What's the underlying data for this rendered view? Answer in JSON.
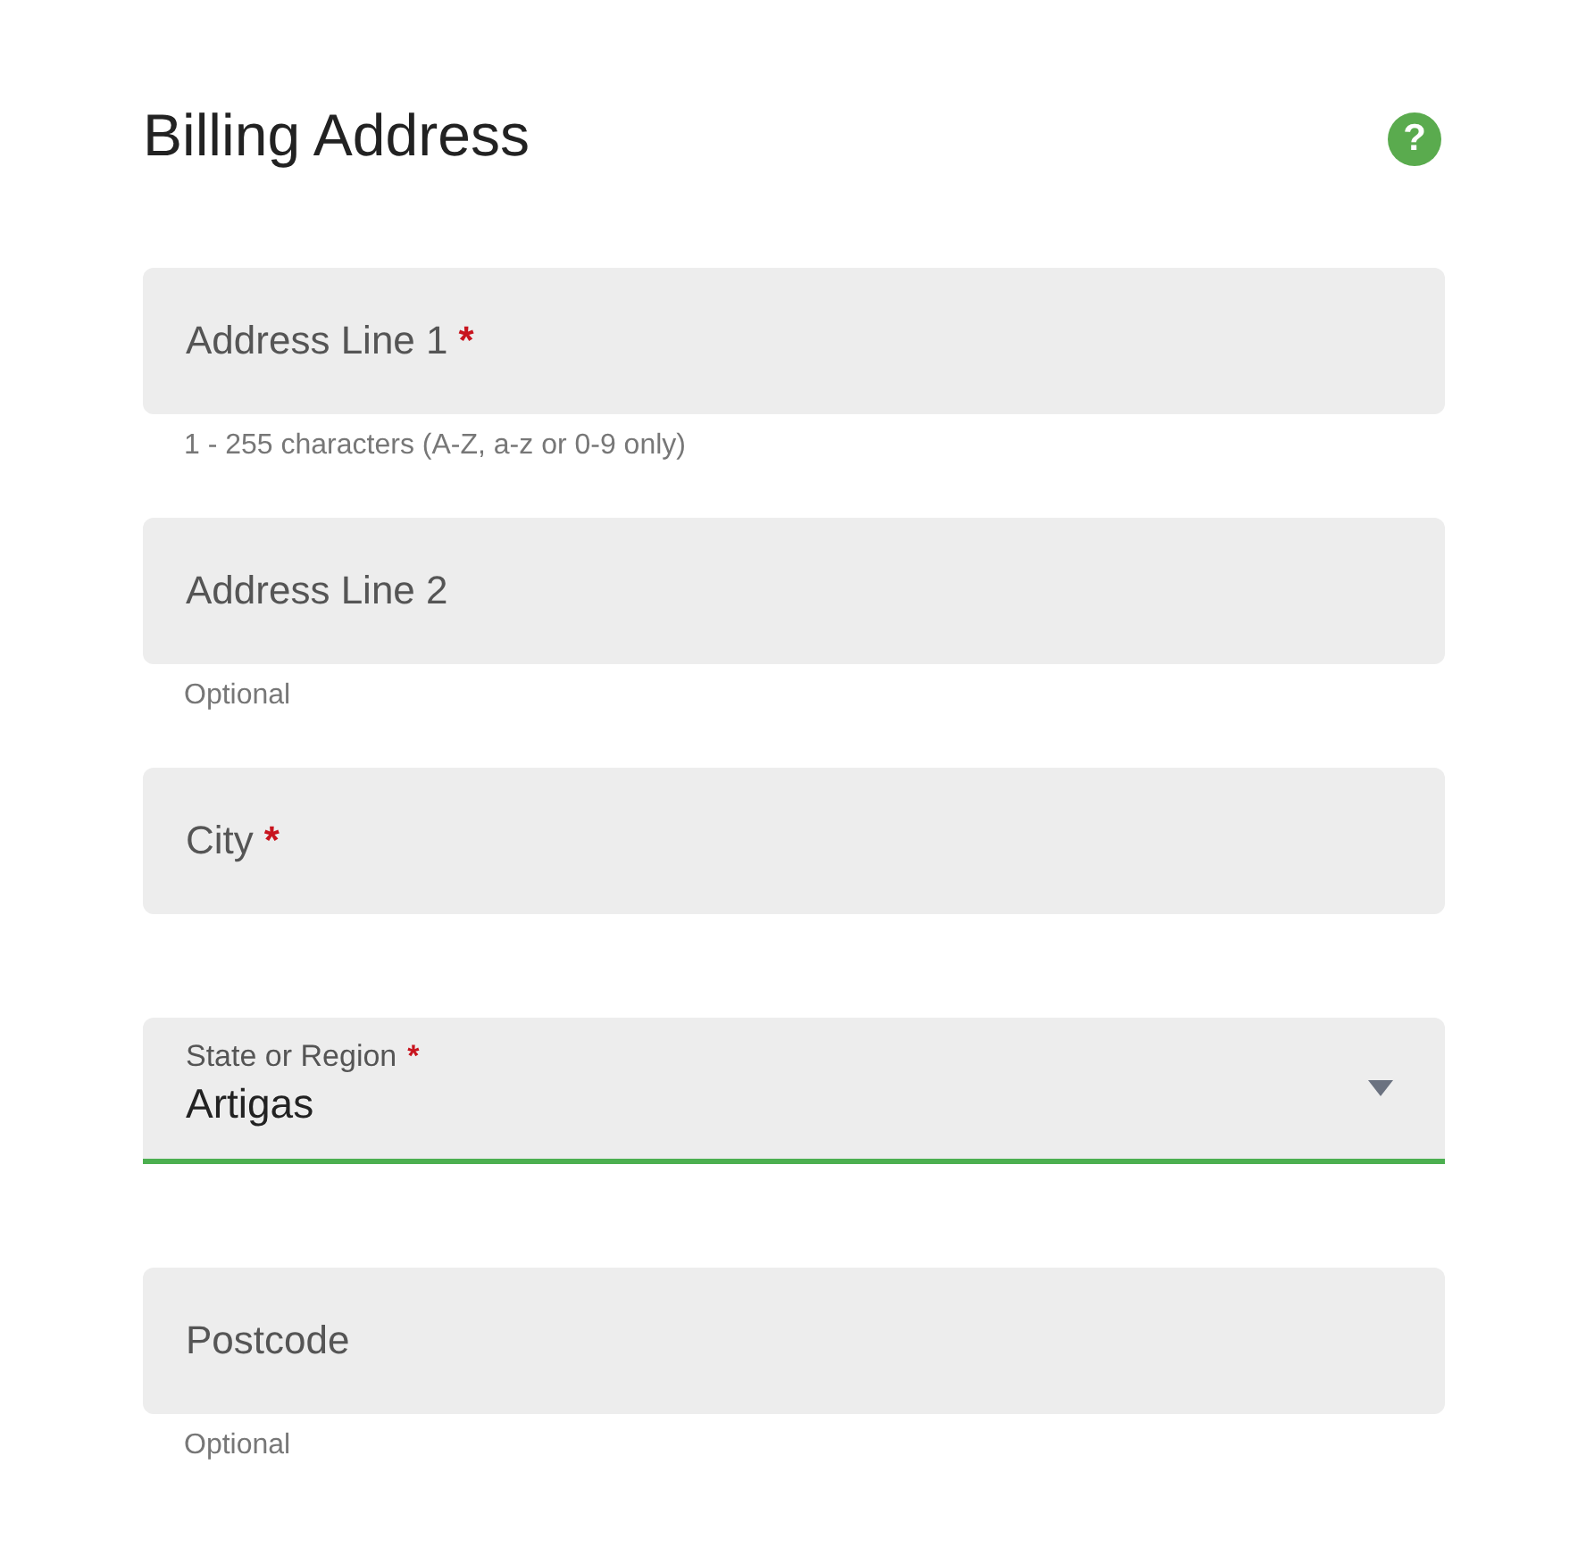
{
  "title": "Billing Address",
  "help": "?",
  "fields": [
    {
      "kind": "text",
      "label": "Address Line 1",
      "required_mark": "*",
      "hint": "1 - 255 characters (A-Z, a-z or 0-9 only)",
      "focused": false
    },
    {
      "kind": "text",
      "label": "Address Line 2",
      "hint": "Optional",
      "focused": false
    },
    {
      "kind": "text",
      "label": "City",
      "required_mark": "*",
      "focused": false
    },
    {
      "kind": "select",
      "label": "State or Region",
      "required_mark": "*",
      "value": "Artigas",
      "focused": true
    },
    {
      "kind": "text",
      "label": "Postcode",
      "hint": "Optional",
      "focused": false
    }
  ]
}
